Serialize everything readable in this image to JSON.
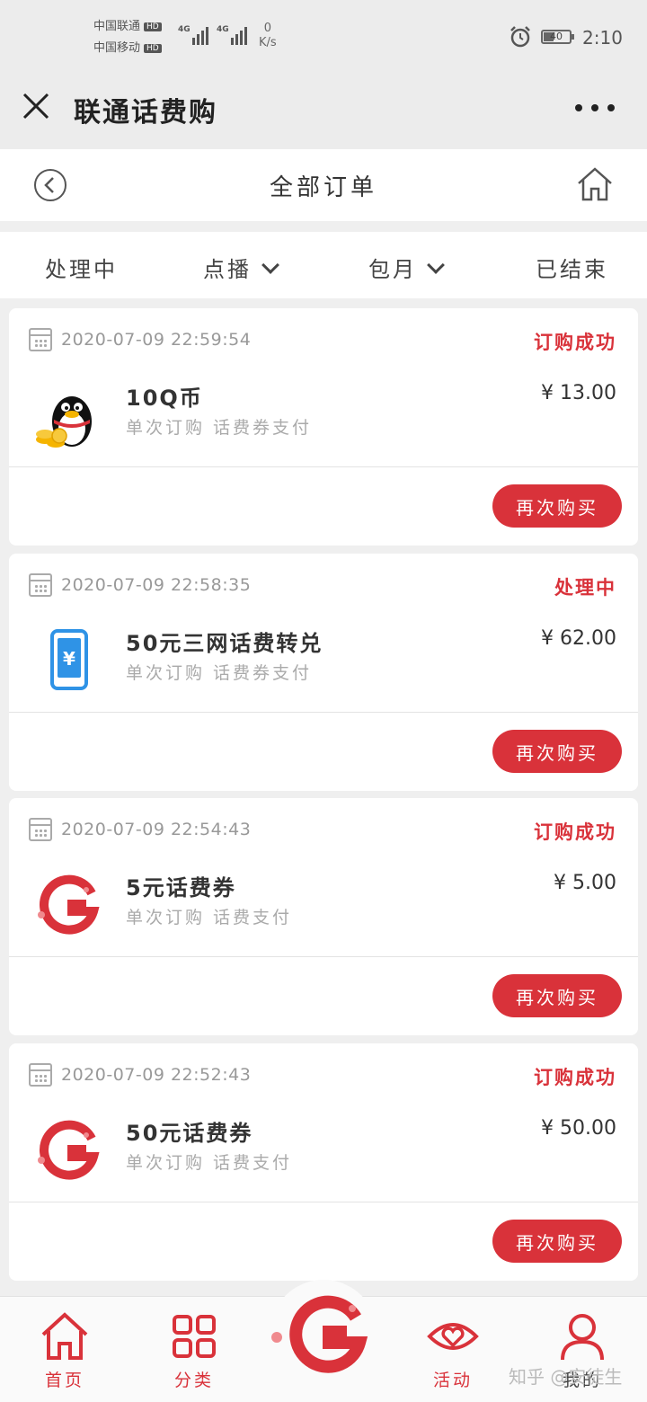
{
  "status_bar": {
    "carrier1": "中国联通",
    "carrier2": "中国移动",
    "hd_badge": "HD",
    "network_type": "4G",
    "speed_value": "0",
    "speed_unit": "K/s",
    "battery_text": "40",
    "battery_level": 0.4,
    "time": "2:10"
  },
  "app_bar": {
    "title": "联通话费购"
  },
  "sub_header": {
    "title": "全部订单"
  },
  "filters": [
    "处理中",
    "点播",
    "包月",
    "已结束"
  ],
  "orders": [
    {
      "date": "2020-07-09 22:59:54",
      "status": "订购成功",
      "name": "10Q币",
      "meta": "单次订购 话费券支付",
      "price": "¥ 13.00",
      "icon": "qq-penguin-icon",
      "button": "再次购买"
    },
    {
      "date": "2020-07-09 22:58:35",
      "status": "处理中",
      "name": "50元三网话费转兑",
      "meta": "单次订购 话费券支付",
      "price": "¥ 62.00",
      "icon": "phone-yuan-icon",
      "button": "再次购买"
    },
    {
      "date": "2020-07-09 22:54:43",
      "status": "订购成功",
      "name": "5元话费券",
      "meta": "单次订购 话费支付",
      "price": "¥ 5.00",
      "icon": "unicom-g-logo-icon",
      "button": "再次购买"
    },
    {
      "date": "2020-07-09 22:52:43",
      "status": "订购成功",
      "name": "50元话费券",
      "meta": "单次订购 话费支付",
      "price": "¥ 50.00",
      "icon": "unicom-g-logo-icon",
      "button": "再次购买"
    }
  ],
  "tab_bar": {
    "home": "首页",
    "category": "分类",
    "activity": "活动",
    "mine": "我的"
  },
  "watermark": "知乎 @安徒生",
  "colors": {
    "accent": "#d9323a",
    "icon_blue": "#2f93e6"
  }
}
